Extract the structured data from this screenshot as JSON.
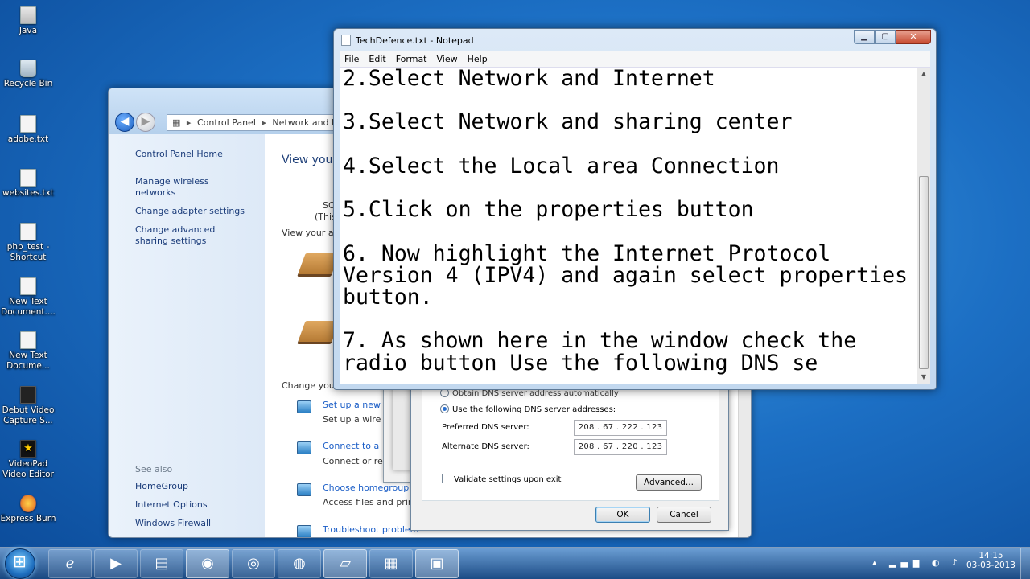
{
  "desktop": {
    "icons": [
      {
        "label": "Java"
      },
      {
        "label": "Recycle Bin"
      },
      {
        "label": "adobe.txt"
      },
      {
        "label": "websites.txt"
      },
      {
        "label": "php_test - Shortcut"
      },
      {
        "label": "New Text Document...."
      },
      {
        "label": "New Text Docume..."
      },
      {
        "label": "Debut Video Capture S..."
      },
      {
        "label": "VideoPad Video Editor"
      },
      {
        "label": "Express Burn"
      }
    ]
  },
  "control_panel": {
    "address": {
      "crumb1": "Control Panel",
      "crumb2": "Network and Int"
    },
    "sidebar": {
      "home": "Control Panel Home",
      "links": [
        "Manage wireless networks",
        "Change adapter settings",
        "Change advanced sharing settings"
      ],
      "see_also": "See also",
      "see_also_links": [
        "HomeGroup",
        "Internet Options",
        "Windows Firewall"
      ]
    },
    "main": {
      "heading": "View your",
      "so_line": "SO",
      "this_line": "(This",
      "view_active": "View your ac",
      "change_your": "Change your",
      "tasks": [
        {
          "link": "Set up a new",
          "desc": "Set up a wire"
        },
        {
          "link": "Connect to a",
          "desc": "Connect or rec"
        },
        {
          "link": "Choose homegroup a",
          "desc": "Access files and printe"
        },
        {
          "link": "Troubleshoot problem",
          "desc": ""
        }
      ]
    }
  },
  "dns_dialog": {
    "obtain_auto": "Obtain DNS server address automatically",
    "use_following": "Use the following DNS server addresses:",
    "preferred_label": "Preferred DNS server:",
    "preferred_value": "208 . 67 . 222 . 123",
    "alternate_label": "Alternate DNS server:",
    "alternate_value": "208 . 67 . 220 . 123",
    "validate_label": "Validate settings upon exit",
    "advanced_label": "Advanced...",
    "ok_label": "OK",
    "cancel_label": "Cancel"
  },
  "notepad": {
    "title": "TechDefence.txt - Notepad",
    "menu": [
      "File",
      "Edit",
      "Format",
      "View",
      "Help"
    ],
    "content": "2.Select Network and Internet\n\n3.Select Network and sharing center\n\n4.Select the Local area Connection\n\n5.Click on the properties button\n\n6. Now highlight the Internet Protocol\nVersion 4 (IPV4) and again select properties\nbutton.\n\n7. As shown here in the window check the\nradio button Use the following DNS se"
  },
  "taskbar": {
    "clock_time": "14:15",
    "clock_date": "03-03-2013"
  }
}
